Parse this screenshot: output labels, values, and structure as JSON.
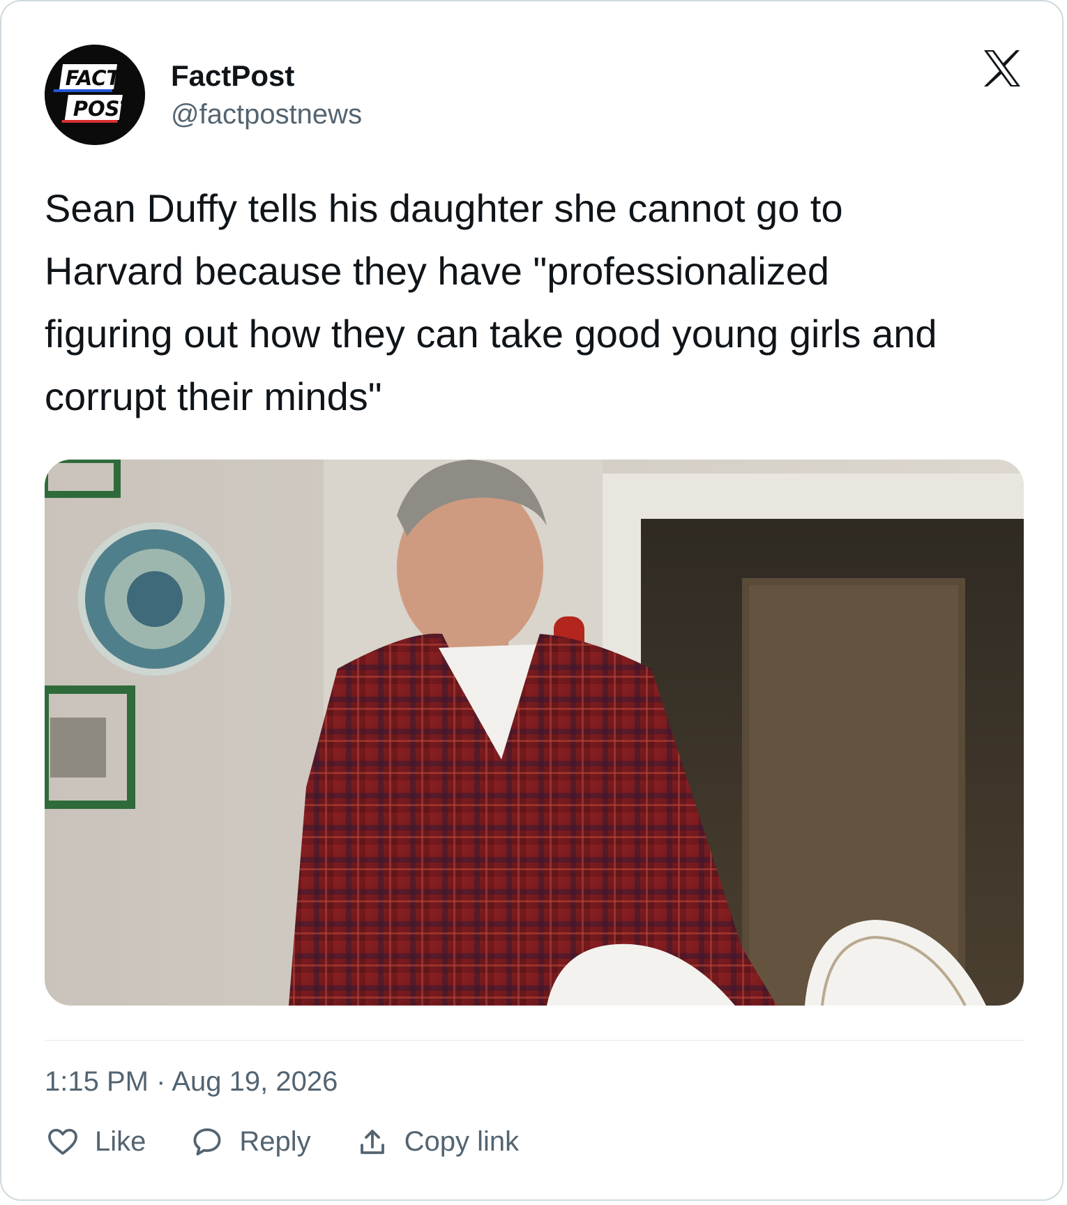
{
  "account": {
    "avatar_text_top": "FACT",
    "avatar_text_bottom": "POST",
    "display_name": "FactPost",
    "handle": "@factpostnews"
  },
  "platform_icon": "x-logo-icon",
  "tweet": {
    "lines": [
      "Sean Duffy tells his daughter she cannot go to",
      "Harvard because they have \"professionalized",
      "figuring out how they can take good young girls and",
      "corrupt their minds\""
    ]
  },
  "media": {
    "kind": "video-still",
    "subject": "man in red plaid shirt in a dining room"
  },
  "meta": {
    "time": "1:15 PM",
    "separator": "·",
    "date": "Aug 19, 2026"
  },
  "actions": [
    {
      "icon": "heart-icon",
      "label": "Like"
    },
    {
      "icon": "speech-bubble-icon",
      "label": "Reply"
    },
    {
      "icon": "share-upload-icon",
      "label": "Copy link"
    }
  ],
  "colors": {
    "text": "#0f1419",
    "secondary": "#536471",
    "border": "#cfd9de",
    "divider": "#eff3f4"
  }
}
